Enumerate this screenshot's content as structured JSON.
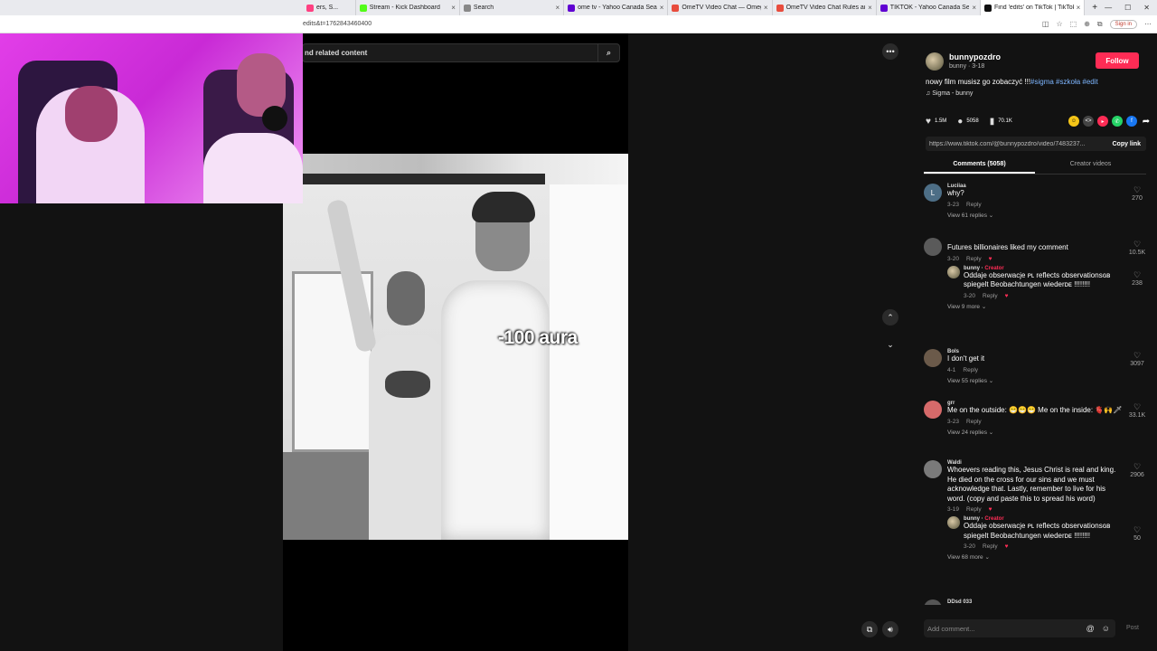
{
  "browser": {
    "tabs": [
      {
        "label": "ers, S...",
        "color": "#ff4081"
      },
      {
        "label": "Stream - Kick Dashboard",
        "color": "#53fc18"
      },
      {
        "label": "Search",
        "color": "#888888"
      },
      {
        "label": "ome tv - Yahoo Canada Search",
        "color": "#6001d2"
      },
      {
        "label": "OmeTV Video Chat — Omegle",
        "color": "#e84c3d"
      },
      {
        "label": "OmeTV Video Chat Rules and R",
        "color": "#e84c3d"
      },
      {
        "label": "TIKTOK - Yahoo Canada Search",
        "color": "#6001d2"
      },
      {
        "label": "Find 'edits' on TikTok | TikTok",
        "color": "#111111"
      }
    ],
    "url": "edits&t=1762843460400",
    "sign_in": "Sign in"
  },
  "search": {
    "placeholder": "nd related content"
  },
  "video": {
    "overlay": "-100 aura"
  },
  "author": {
    "name": "bunnypozdro",
    "sub": "bunny · 3-18",
    "follow": "Follow",
    "caption": "nowy film musisz go zobaczyć !!!",
    "tags": "#sigma #szkoła #edit",
    "music": "Sigma - bunny"
  },
  "stats": {
    "likes": "1.5M",
    "comments": "5058",
    "saves": "70.1K"
  },
  "link": {
    "url": "https://www.tiktok.com/@bunnypozdro/video/7483237...",
    "copy": "Copy link"
  },
  "tabs": {
    "comments": "Comments (5058)",
    "creator": "Creator videos"
  },
  "comments": [
    {
      "name": "Luciiaa",
      "text": "why?",
      "date": "3-23",
      "reply": "Reply",
      "likes": "270",
      "replies": "View 61 replies"
    },
    {
      "name": "",
      "text": "Futures billionaires liked my comment",
      "date": "3-20",
      "reply": "Reply",
      "likes": "10.5K"
    },
    {
      "name": "bunny",
      "creator": "Creator",
      "text": "Oddaje obserwacje ᴘʟ reflects observationsɢʙ spiegelt Beobachtungen wiederᴅᴇ !!!!!!!!",
      "date": "3-20",
      "reply": "Reply",
      "likes": "238",
      "replies": "View 9 more"
    },
    {
      "name": "Bols",
      "text": "I don't get it",
      "date": "4-1",
      "reply": "Reply",
      "likes": "3097",
      "replies": "View 55 replies"
    },
    {
      "name": "grr",
      "text": "Me on the outside: 😁😁😁 Me on the inside: 🫀🙌🗡",
      "date": "3-23",
      "reply": "Reply",
      "likes": "33.1K",
      "replies": "View 24 replies"
    },
    {
      "name": "Waldi",
      "text": "Whoevers reading this, Jesus Christ is real and king. He died on the cross for our sins and we must acknowledge that. Lastly, remember to live for his word. (copy and paste this to spread his word)",
      "date": "3-19",
      "reply": "Reply",
      "likes": "2906"
    },
    {
      "name": "bunny",
      "creator": "Creator",
      "text": "Oddaje obserwacje ᴘʟ reflects observationsɢʙ spiegelt Beobachtungen wiederᴅᴇ !!!!!!!!",
      "date": "3-20",
      "reply": "Reply",
      "likes": "50",
      "replies": "View 68 more"
    },
    {
      "name": "DDsd 033",
      "text": ""
    }
  ],
  "footer": {
    "add_comment": "Add comment...",
    "post": "Post"
  },
  "colors": {
    "accent": "#fe2c55",
    "tag": "#7eb6ff"
  }
}
